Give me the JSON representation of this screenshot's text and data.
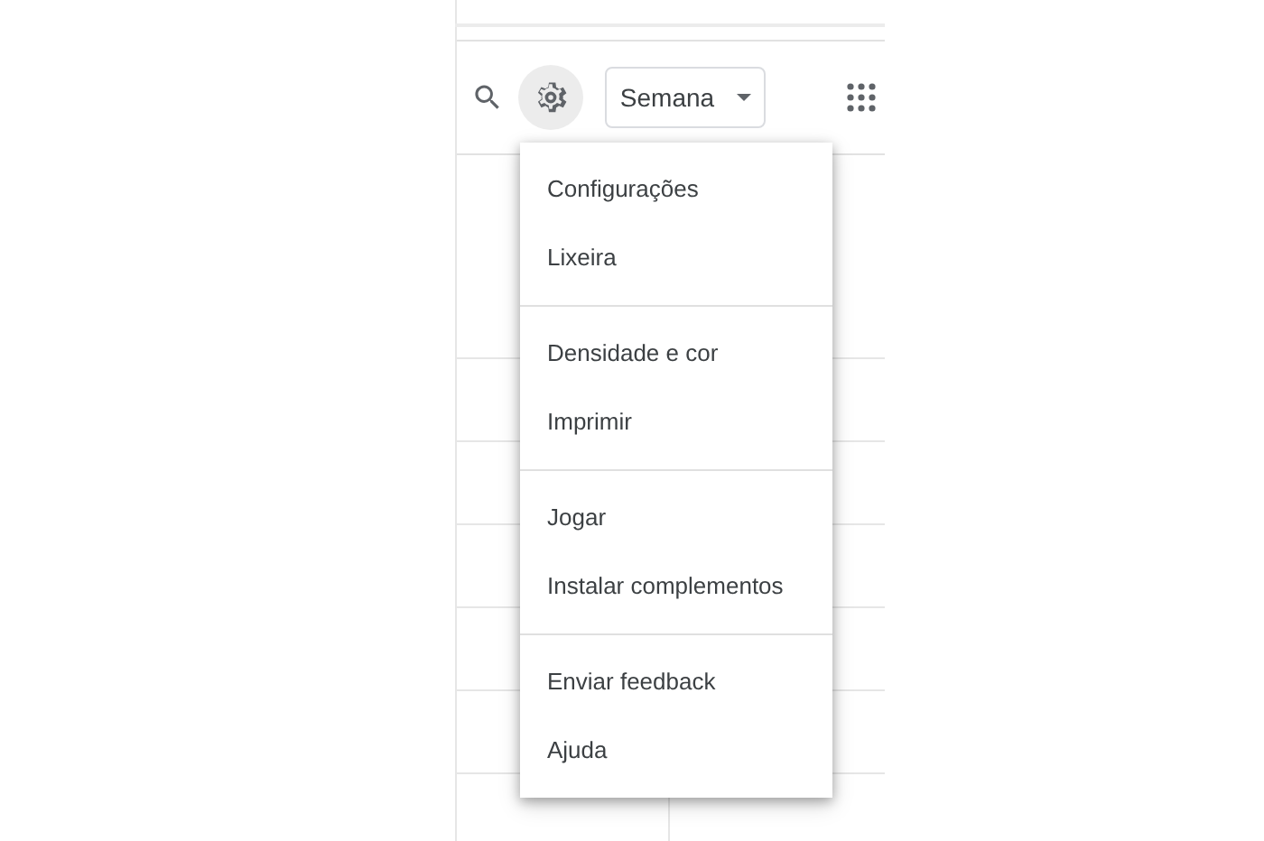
{
  "toolbar": {
    "view_selector": "Semana"
  },
  "settings_menu": {
    "sections": [
      {
        "items": [
          "Configurações",
          "Lixeira"
        ]
      },
      {
        "items": [
          "Densidade e cor",
          "Imprimir"
        ]
      },
      {
        "items": [
          "Jogar",
          "Instalar complementos"
        ]
      },
      {
        "items": [
          "Enviar feedback",
          "Ajuda"
        ]
      }
    ]
  }
}
